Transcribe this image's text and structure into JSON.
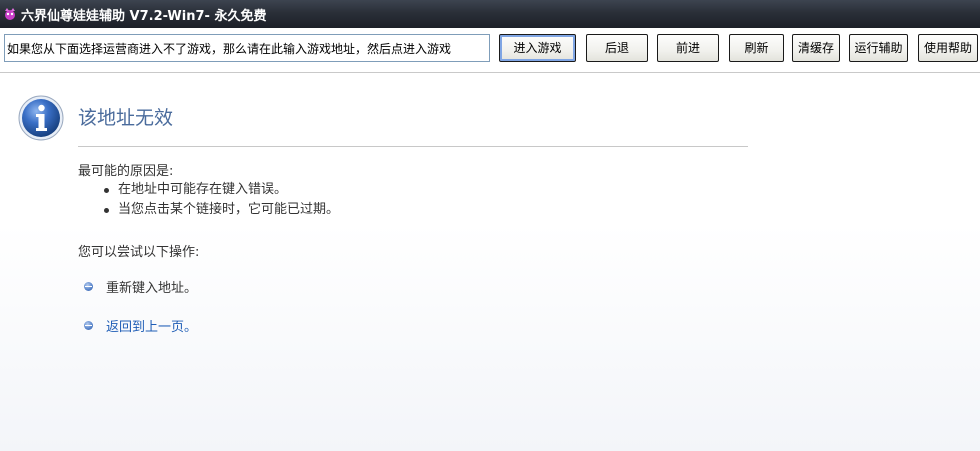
{
  "window": {
    "title": "六界仙尊娃娃辅助 V7.2-Win7- 永久免费"
  },
  "toolbar": {
    "url_value": "如果您从下面选择运营商进入不了游戏，那么请在此输入游戏地址，然后点进入游戏",
    "buttons": {
      "enter_game": "进入游戏",
      "back": "后退",
      "forward": "前进",
      "refresh": "刷新",
      "clear_cache": "清缓存",
      "run_helper": "运行辅助",
      "help": "使用帮助"
    }
  },
  "error_page": {
    "title": "该地址无效",
    "reason_heading": "最可能的原因是:",
    "reasons": [
      "在地址中可能存在键入错误。",
      "当您点击某个链接时，它可能已过期。"
    ],
    "try_heading": "您可以尝试以下操作:",
    "actions": [
      "重新键入地址。",
      "返回到上一页。"
    ]
  },
  "colors": {
    "titlebar": "#2a2f38",
    "title_text": "#ffffff",
    "error_title": "#4a6b9c",
    "link": "#1f5db6",
    "body_text": "#333333"
  }
}
